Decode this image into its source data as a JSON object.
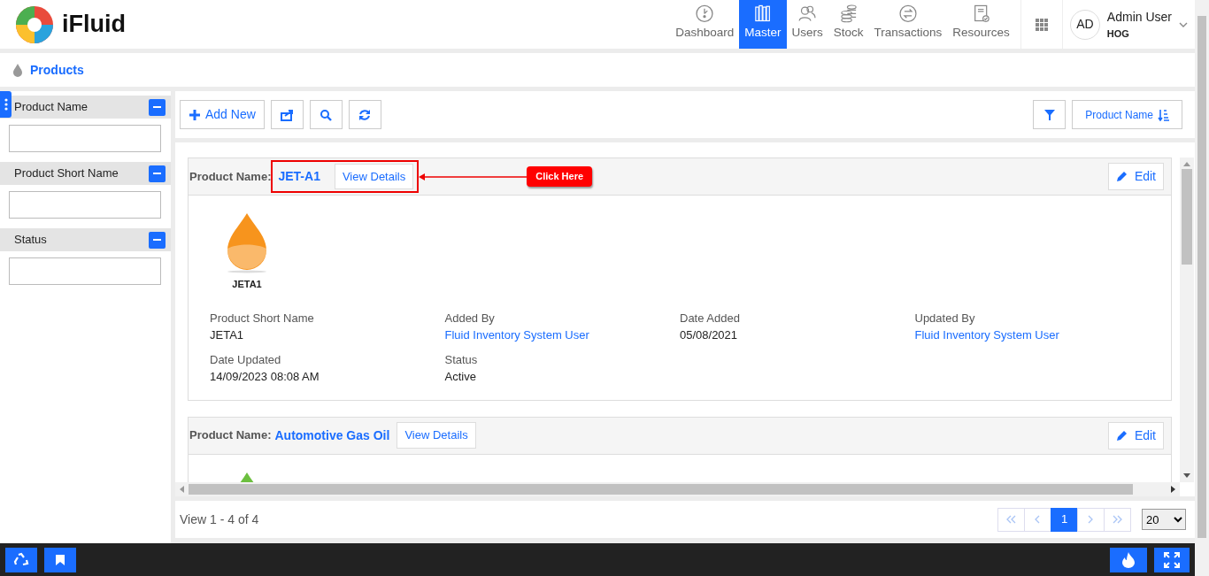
{
  "app": {
    "logo_text": "iFluid"
  },
  "nav": [
    {
      "kind": "gauge",
      "label": "Dashboard",
      "selected": false
    },
    {
      "kind": "binders",
      "label": "Master",
      "selected": true
    },
    {
      "kind": "users",
      "label": "Users",
      "selected": false
    },
    {
      "kind": "coins",
      "label": "Stock",
      "selected": false
    },
    {
      "kind": "exchange",
      "label": "Transactions",
      "selected": false
    },
    {
      "kind": "book",
      "label": "Resources",
      "selected": false
    }
  ],
  "user": {
    "initials": "AD",
    "name": "Admin User",
    "role": "HOG"
  },
  "breadcrumb": {
    "title": "Products"
  },
  "filters": [
    {
      "label": "Product Name"
    },
    {
      "label": "Product Short Name"
    },
    {
      "label": "Status"
    }
  ],
  "toolbar": {
    "buttons": [
      {
        "kind": "add",
        "label": "Add New"
      },
      {
        "kind": "export"
      },
      {
        "kind": "search"
      },
      {
        "kind": "refresh"
      }
    ],
    "sort_label": "Product Name"
  },
  "products": [
    {
      "name_label": "Product Name:",
      "name": "JET-A1",
      "view_label": "View Details",
      "edit_label": "Edit",
      "callout": "Click Here",
      "image_label": "JETA1",
      "color": "#f7941d",
      "fields": [
        {
          "label": "Product Short Name",
          "value": "JETA1",
          "link": false
        },
        {
          "label": "Added By",
          "value": "Fluid Inventory System User",
          "link": true
        },
        {
          "label": "Date Added",
          "value": "05/08/2021",
          "link": false
        },
        {
          "label": "Updated By",
          "value": "Fluid Inventory System User",
          "link": true
        },
        {
          "label": "Date Updated",
          "value": "14/09/2023 08:08 AM",
          "link": false
        },
        {
          "label": "Status",
          "value": "Active",
          "link": false
        }
      ]
    },
    {
      "name_label": "Product Name:",
      "name": "Automotive Gas Oil",
      "view_label": "View Details",
      "edit_label": "Edit",
      "color": "#6cbf3f"
    }
  ],
  "pager": {
    "summary": "View 1 - 4 of 4",
    "controls": [
      {
        "kind": "first",
        "disabled": true
      },
      {
        "kind": "prev",
        "disabled": true
      },
      {
        "kind": "page",
        "label": "1",
        "selected": true
      },
      {
        "kind": "next",
        "disabled": true
      },
      {
        "kind": "last",
        "disabled": true
      }
    ],
    "page_size": "20"
  }
}
